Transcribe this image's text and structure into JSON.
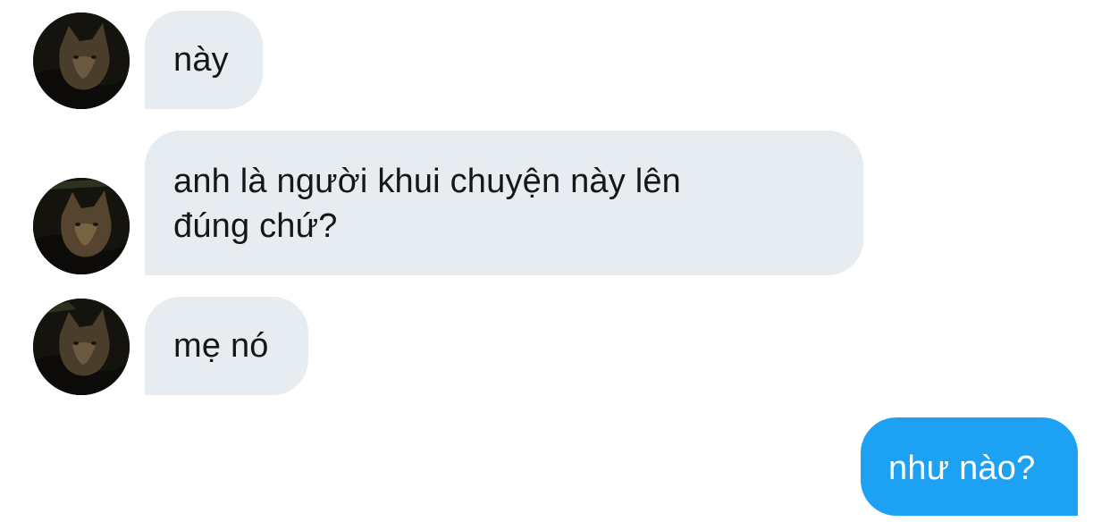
{
  "conversation": {
    "messages": [
      {
        "sender": "other",
        "lines": [
          "này"
        ]
      },
      {
        "sender": "other",
        "lines": [
          "anh là người khui chuyện này lên",
          "đúng chứ?"
        ]
      },
      {
        "sender": "other",
        "lines": [
          "mẹ nó"
        ]
      },
      {
        "sender": "self",
        "lines": [
          "như nào?"
        ]
      }
    ]
  },
  "icons": {
    "avatar": "cat-photo-avatar-icon"
  },
  "colors": {
    "incoming_bubble": "#e6ecf0",
    "incoming_text": "#14171a",
    "outgoing_bubble": "#1da1f2",
    "outgoing_text": "#ffffff",
    "background": "#ffffff"
  }
}
